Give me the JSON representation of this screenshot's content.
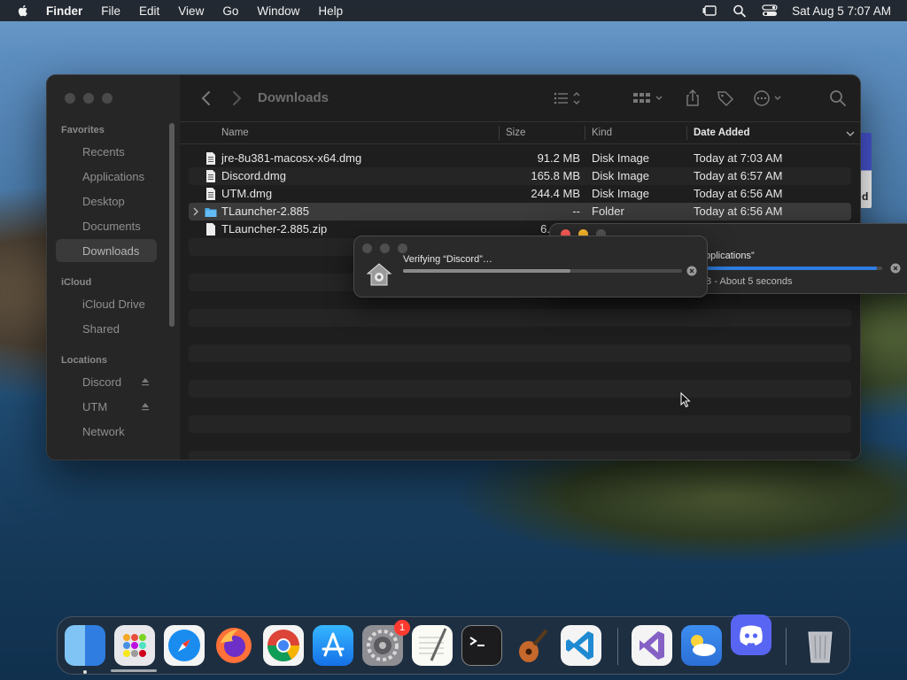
{
  "menubar": {
    "app": "Finder",
    "items": [
      "File",
      "Edit",
      "View",
      "Go",
      "Window",
      "Help"
    ],
    "clock": "Sat Aug 5  7:07 AM"
  },
  "finder": {
    "title": "Downloads",
    "sidebar": {
      "favorites_label": "Favorites",
      "favorites": [
        "Recents",
        "Applications",
        "Desktop",
        "Documents",
        "Downloads"
      ],
      "icloud_label": "iCloud",
      "icloud": [
        "iCloud Drive",
        "Shared"
      ],
      "locations_label": "Locations",
      "locations": [
        "Discord",
        "UTM",
        "Network"
      ]
    },
    "columns": {
      "name": "Name",
      "size": "Size",
      "kind": "Kind",
      "date": "Date Added"
    },
    "rows": [
      {
        "name": "jre-8u381-macosx-x64.dmg",
        "size": "91.2 MB",
        "kind": "Disk Image",
        "date": "Today at 7:03 AM"
      },
      {
        "name": "Discord.dmg",
        "size": "165.8 MB",
        "kind": "Disk Image",
        "date": "Today at 6:57 AM"
      },
      {
        "name": "UTM.dmg",
        "size": "244.4 MB",
        "kind": "Disk Image",
        "date": "Today at 6:56 AM"
      },
      {
        "name": "TLauncher-2.885",
        "size": "--",
        "kind": "Folder",
        "date": "Today at 6:56 AM"
      },
      {
        "name": "TLauncher-2.885.zip",
        "size": "6.",
        "kind": "",
        "date": ""
      }
    ]
  },
  "verify_dialog": {
    "text": "Verifying “Discord”…",
    "progress": 0.6
  },
  "copy_dialog": {
    "text": "pplications”",
    "status": "B - About 5 seconds",
    "progress": 0.97
  },
  "dmg_window": {
    "letter": "d"
  },
  "dock": {
    "settings_badge": "1"
  },
  "colors": {
    "accent": "#2f7de0",
    "folder": "#4aa8e8",
    "badge": "#ff3b30"
  }
}
